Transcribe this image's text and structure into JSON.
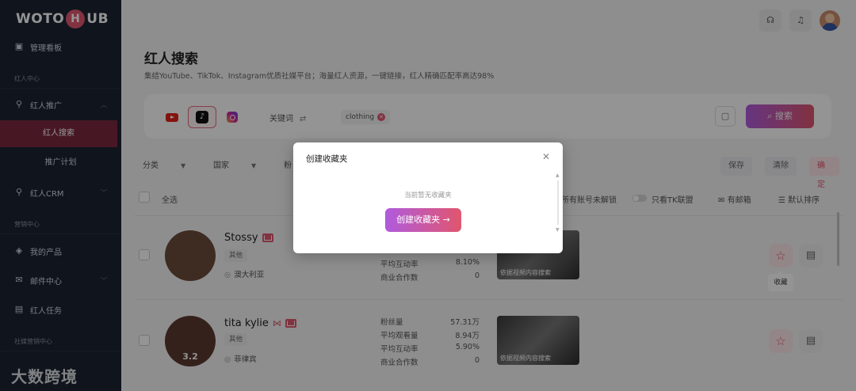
{
  "brand": {
    "logo_left": "WOTO",
    "logo_mark": "H",
    "logo_right": "UB"
  },
  "sidebar": {
    "dashboard": "管理看板",
    "section_influencer": "红人中心",
    "influencer_promo": "红人推广",
    "influencer_search": "红人搜索",
    "promo_plan": "推广计划",
    "influencer_crm": "红人CRM",
    "section_marketing": "营销中心",
    "my_products": "我的产品",
    "mail_center": "邮件中心",
    "influencer_tasks": "红人任务",
    "section_social": "社媒营销中心",
    "watermark": "大数跨境"
  },
  "page": {
    "title": "红人搜索",
    "subtitle": "集结YouTube、TikTok、Instagram优质社媒平台；海量红人资源，一键链接，红人精确匹配率高达98%"
  },
  "search": {
    "keyword_label": "关键词",
    "tag": "clothing",
    "button": "搜索"
  },
  "filters": {
    "category": "分类",
    "country": "国家",
    "fans_partial": "粉",
    "save": "保存",
    "clear": "清除",
    "confirm": "确定"
  },
  "table_head": {
    "select_all": "全选",
    "unlock_partial": "所有账号未解锁",
    "tk_only": "只看TK联盟",
    "has_email": "有邮箱",
    "default_sort": "默认排序"
  },
  "rows": [
    {
      "name": "Stossy",
      "category": "其他",
      "location": "澳大利亚",
      "score": "",
      "stats": [
        {
          "label": "平均互动率",
          "value": "8.10%"
        },
        {
          "label": "商业合作数",
          "value": "0"
        }
      ],
      "thumb_caption": "依据视频内容搜索"
    },
    {
      "name": "tita kylie",
      "category": "其他",
      "location": "菲律宾",
      "score": "3.2",
      "stats": [
        {
          "label": "粉丝量",
          "value": "57.31万"
        },
        {
          "label": "平均观看量",
          "value": "8.94万"
        },
        {
          "label": "平均互动率",
          "value": "5.90%"
        },
        {
          "label": "商业合作数",
          "value": "0"
        }
      ],
      "thumb_caption": "依据视频内容搜索"
    }
  ],
  "tooltip": {
    "favorite": "收藏"
  },
  "modal": {
    "title": "创建收藏夹",
    "empty_text": "当前暂无收藏夹",
    "create_button": "创建收藏夹"
  },
  "colors": {
    "accent": "#e0566e",
    "accent_purple": "#b05bde",
    "sidebar_bg": "#1b2433"
  }
}
